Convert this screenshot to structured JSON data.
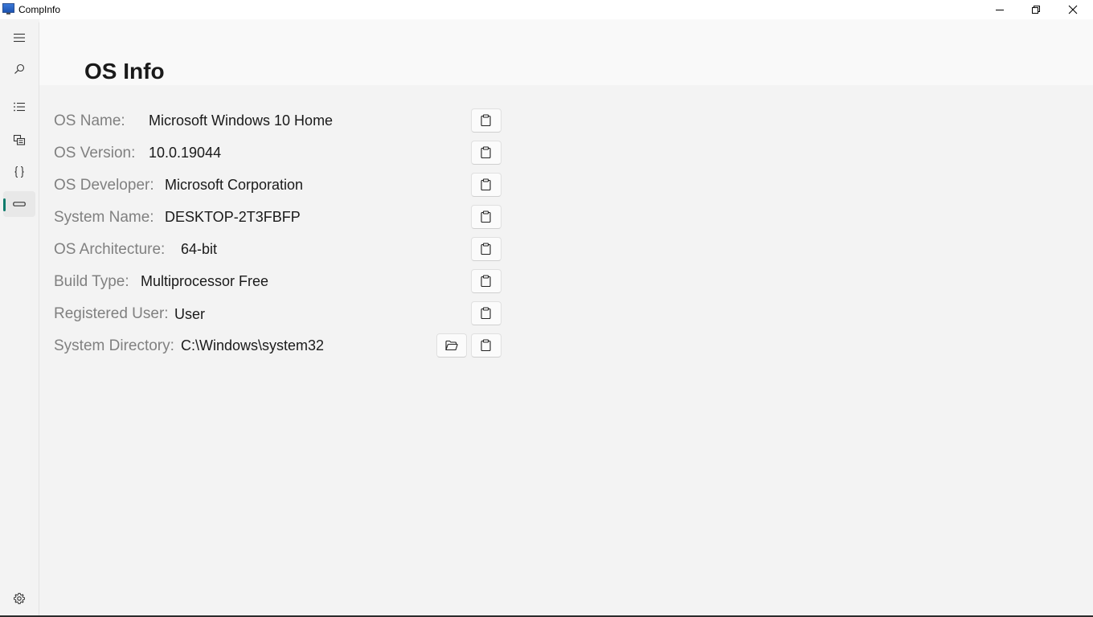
{
  "window": {
    "title": "CompInfo"
  },
  "nav": {
    "items": [
      {
        "name": "menu",
        "icon": "hamburger-menu-icon"
      },
      {
        "name": "search",
        "icon": "search-icon"
      },
      {
        "name": "list",
        "icon": "list-icon"
      },
      {
        "name": "copy-pages",
        "icon": "copy-pages-icon"
      },
      {
        "name": "braces",
        "icon": "braces-icon"
      },
      {
        "name": "os-info",
        "icon": "drive-bar-icon",
        "selected": true
      },
      {
        "name": "settings",
        "icon": "gear-icon"
      }
    ],
    "accent": "#0f7b6c"
  },
  "page": {
    "title": "OS Info"
  },
  "rows": [
    {
      "label": "OS Name:",
      "value": "Microsoft Windows 10 Home"
    },
    {
      "label": "OS Version:",
      "value": "10.0.19044"
    },
    {
      "label": "OS Developer:",
      "value": "Microsoft Corporation"
    },
    {
      "label": "System Name:",
      "value": "DESKTOP-2T3FBFP"
    },
    {
      "label": "OS Architecture:",
      "value": "64-bit"
    },
    {
      "label": "Build Type:",
      "value": "Multiprocessor Free"
    },
    {
      "label": "Registered User:",
      "value": "User"
    },
    {
      "label": "System Directory:",
      "value": "C:\\Windows\\system32"
    }
  ],
  "icons": {
    "copy": "copy-icon",
    "open_folder": "folder-open-icon"
  }
}
